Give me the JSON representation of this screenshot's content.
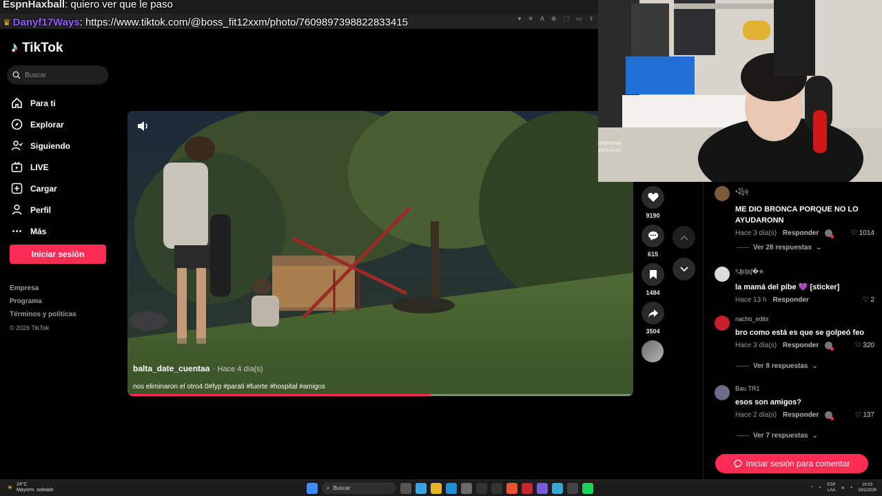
{
  "chat": {
    "line1": {
      "user": "EspnHaxball",
      "text": ": quiero ver que le paso"
    },
    "line2": {
      "user": "Danyf17Ways",
      "text": ": https://www.tiktok.com/@boss_fit12xxm/photo/7609897398822833415"
    }
  },
  "sidebar": {
    "logo": "TikTok",
    "search_placeholder": "Buscar",
    "items": [
      {
        "label": "Para ti",
        "icon": "home-icon"
      },
      {
        "label": "Explorar",
        "icon": "compass-icon"
      },
      {
        "label": "Siguiendo",
        "icon": "following-icon"
      },
      {
        "label": "LIVE",
        "icon": "live-icon"
      },
      {
        "label": "Cargar",
        "icon": "upload-icon"
      },
      {
        "label": "Perfil",
        "icon": "profile-icon"
      },
      {
        "label": "Más",
        "icon": "more-icon"
      }
    ],
    "login": "Iniciar sesión",
    "footer": [
      "Empresa",
      "Programa",
      "Términos y políticas",
      "© 2026 TikTok"
    ]
  },
  "video": {
    "author": "balta_date_cuentaa",
    "time": "· Hace 4 día(s)",
    "caption": "nos eliminaron el otro4.0#fyp #parati #fuerte #hospital #amigos",
    "progress": 0.6
  },
  "actions": {
    "likes": "9190",
    "comments": "615",
    "saves": "1484",
    "shares": "3504"
  },
  "comments": [
    {
      "user": "꧁ৡ",
      "text": "ME DIO BRONCA PORQUE NO LO AYUDARONN",
      "time": "Hace 3 día(s)",
      "reply": "Responder",
      "likes": "1014",
      "liked_by_creator": true,
      "replies": "Ver 28 respuestas"
    },
    {
      "user": "ৎ₰ɛ§ɛʃ�✯",
      "text": "la mamá del pibe 💜 [sticker]",
      "time": "Hace 13 h",
      "reply": "Responder",
      "likes": "2",
      "liked_by_creator": false,
      "replies": ""
    },
    {
      "user": "nacho_edits",
      "text": "bro como está es que se golpeó feo",
      "time": "Hace 3 día(s)",
      "reply": "Responder",
      "likes": "320",
      "liked_by_creator": true,
      "replies": "Ver 8 respuestas"
    },
    {
      "user": "Bau TR1",
      "text": "esos son amigos?",
      "time": "Hace 2 día(s)",
      "reply": "Responder",
      "likes": "137",
      "liked_by_creator": true,
      "replies": "Ver 7 respuestas"
    }
  ],
  "comment_login": "Iniciar sesión para comentar",
  "webcam_overlay": {
    "l1": "USER BANA",
    "l2": "VOTA A LAS"
  },
  "taskbar": {
    "temp": "24°C",
    "weather": "Mayorm. soleado",
    "search": "Buscar",
    "lang1": "ESP",
    "lang2": "LAA",
    "time": "16:03",
    "date": "28/2/2026"
  },
  "colors": {
    "accent": "#fe2c55",
    "bg": "#000000",
    "panel": "#1e1e1e"
  }
}
